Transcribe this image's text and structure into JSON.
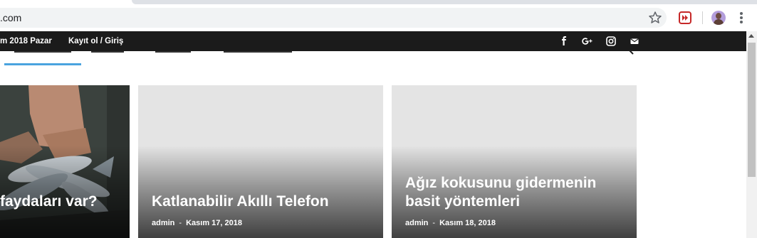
{
  "browser": {
    "address_text": ".com"
  },
  "topbar": {
    "date": "m 2018 Pazar",
    "login": "Kayıt ol / Giriş",
    "social": [
      "facebook-icon",
      "google-plus-icon",
      "instagram-icon",
      "mail-icon"
    ]
  },
  "nav": {
    "active_underline_color": "#4aa3df"
  },
  "cards": [
    {
      "title": "faydaları var?",
      "author": "",
      "date": ""
    },
    {
      "title": "Katlanabilir Akıllı Telefon",
      "author": "admin",
      "date": "Kasım 17, 2018"
    },
    {
      "title_line1": "Ağız kokusunu gidermenin",
      "title_line2": "basit yöntemleri",
      "author": "admin",
      "date": "Kasım 18, 2018"
    }
  ],
  "colors": {
    "topbar_bg": "#1b1b1b",
    "card_placeholder": "#e4e4e4",
    "extension_red": "#c62828"
  }
}
